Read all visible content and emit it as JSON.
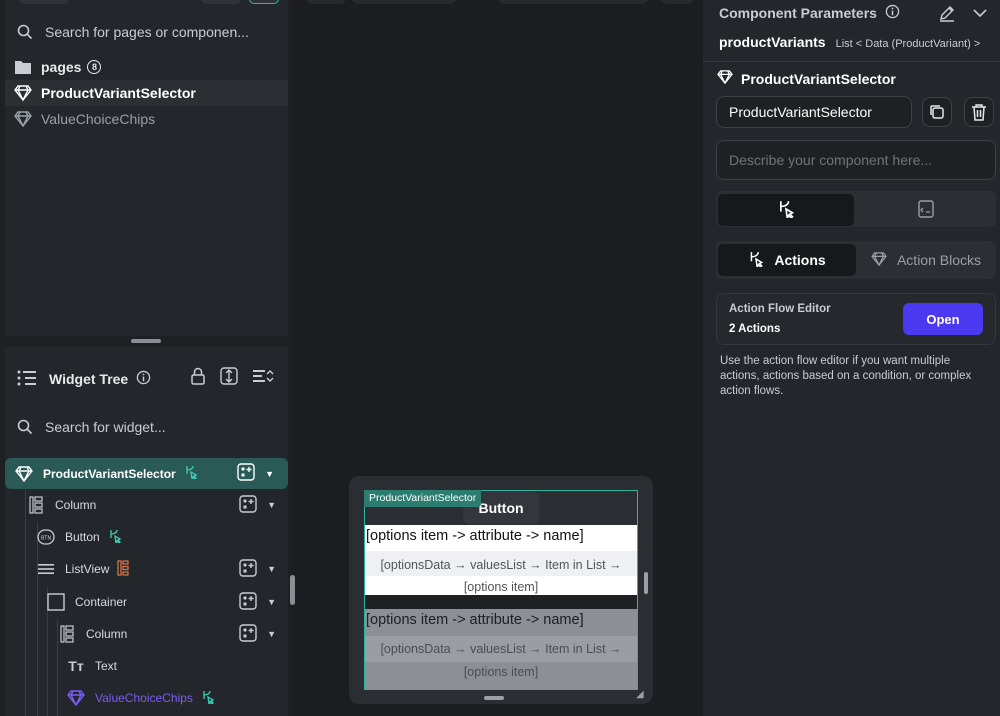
{
  "left_panel": {
    "search_placeholder": "Search for pages or componen...",
    "pages_folder": {
      "label": "pages",
      "count": "8"
    },
    "items": [
      {
        "label": "ProductVariantSelector",
        "selected": true
      },
      {
        "label": "ValueChoiceChips",
        "selected": false
      }
    ]
  },
  "widget_tree": {
    "title": "Widget Tree",
    "search_placeholder": "Search for widget...",
    "nodes": [
      {
        "label": "ProductVariantSelector"
      },
      {
        "label": "Column"
      },
      {
        "label": "Button"
      },
      {
        "label": "ListView"
      },
      {
        "label": "Container"
      },
      {
        "label": "Column"
      },
      {
        "label": "Text"
      },
      {
        "label": "ValueChoiceChips"
      }
    ],
    "button_icon_text": "BTN"
  },
  "canvas": {
    "component_tag": "ProductVariantSelector",
    "button_label": "Button",
    "list_items": [
      {
        "title": "[options item -> attribute -> name]",
        "line1": "[optionsData → valuesList → Item in List →",
        "line2": "[options item]"
      },
      {
        "title": "[options item -> attribute -> name]",
        "line1": "[optionsData → valuesList → Item in List →",
        "line2": "[options item]"
      }
    ]
  },
  "right_panel": {
    "title": "Component Parameters",
    "param_name": "productVariants",
    "param_type": "List < Data (ProductVariant) >",
    "component_name": "ProductVariantSelector",
    "name_input_value": "ProductVariantSelector",
    "description_placeholder": "Describe your component here...",
    "tabs": {
      "actions": "Actions",
      "action_blocks": "Action Blocks"
    },
    "action_flow": {
      "title": "Action Flow Editor",
      "count": "2 Actions",
      "open": "Open"
    },
    "help_text": "Use the action flow editor if you want multiple actions, actions based on a condition, or complex action flows."
  },
  "colors": {
    "accent_teal": "#2fb59f",
    "primary_button": "#4b39ef",
    "selected_row": "#2a5a55",
    "purple_icon": "#7b5cf5"
  }
}
